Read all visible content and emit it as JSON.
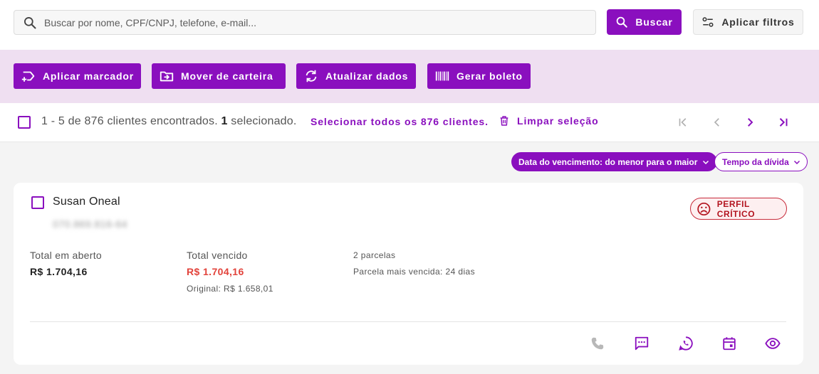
{
  "search": {
    "placeholder": "Buscar por nome, CPF/CNPJ, telefone, e-mail...",
    "search_icon": "search-icon",
    "button_label": "Buscar",
    "filters_label": "Aplicar filtros",
    "filters_icon": "sliders-icon"
  },
  "actions": [
    {
      "label": "Aplicar marcador",
      "icon": "label-plus-icon"
    },
    {
      "label": "Mover de carteira",
      "icon": "folder-move-icon"
    },
    {
      "label": "Atualizar dados",
      "icon": "refresh-icon"
    },
    {
      "label": "Gerar boleto",
      "icon": "barcode-icon"
    }
  ],
  "selection": {
    "range": "1 - 5",
    "total_text": "de 876 clientes encontrados.",
    "selected_count": "1",
    "selected_text": "selecionado.",
    "select_all_label": "Selecionar todos os 876 clientes.",
    "clear_label": "Limpar seleção"
  },
  "sort": {
    "active_label": "Data do vencimento: do menor para o maior",
    "secondary_label": "Tempo da dívida"
  },
  "client": {
    "name": "Susan Oneal",
    "document": "070.869.816-64",
    "profile_badge": "PERFIL CRÍTICO",
    "total_open_label": "Total em aberto",
    "total_open_value": "R$ 1.704,16",
    "total_due_label": "Total vencido",
    "total_due_value": "R$ 1.704,16",
    "original_text": "Original: R$ 1.658,01",
    "installments": "2 parcelas",
    "oldest_installment": "Parcela mais vencida: 24 dias"
  },
  "colors": {
    "primary": "#8a0fbe",
    "action_bar_bg": "#efdff1",
    "danger": "#e2433b",
    "badge_border": "#c72a3a"
  }
}
